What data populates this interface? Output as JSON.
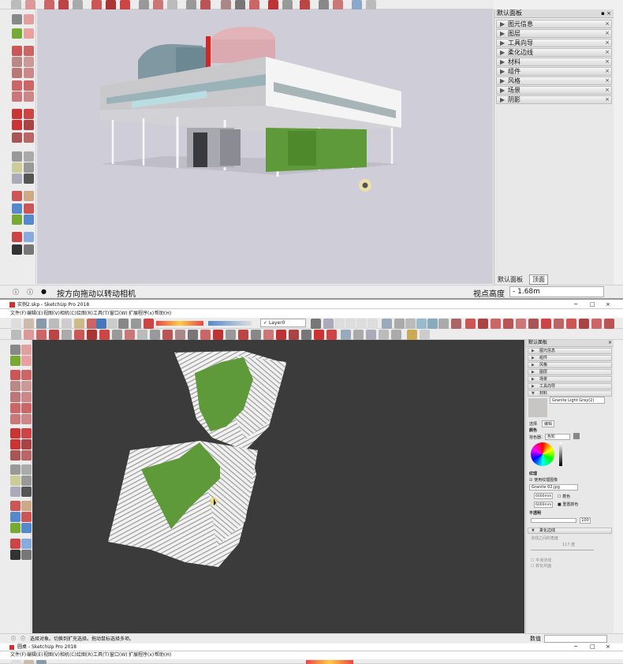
{
  "top": {
    "right_panel": {
      "title": "默认面板",
      "sections": [
        "图元信息",
        "图层",
        "工具向导",
        "柔化边线",
        "材料",
        "组件",
        "风格",
        "场景",
        "阴影"
      ],
      "tabs": [
        "默认面板",
        "顶面"
      ]
    },
    "status_text": "按方向拖动以转动相机",
    "measure_label": "视点高度",
    "measure_value": "- 1.68m"
  },
  "middle": {
    "window_title": "实例2.skp - SketchUp Pro 2018",
    "menu": [
      "文件(F)",
      "编辑(E)",
      "视图(V)",
      "相机(C)",
      "绘图(R)",
      "工具(T)",
      "窗口(W)",
      "扩展程序(x)",
      "帮助(H)"
    ],
    "layer_select": "Layer0",
    "right_panel": {
      "title": "默认面板",
      "sections": [
        "图元信息",
        "组件",
        "风格",
        "图层",
        "场景",
        "工具向导",
        "材料"
      ],
      "material_name": "Granite Light Gray(2)",
      "tabs": [
        "选择",
        "编辑"
      ],
      "color_label": "颜色",
      "picker_label": "拾色器：",
      "picker_value": "色轮",
      "texture_label": "纹理",
      "use_texture": "使用纹理图像",
      "texture_file": "Granite 02.jpg",
      "width_value": "6000mm",
      "height_value": "6000mm",
      "colorize_label": "着色",
      "reset_label": "重置颜色",
      "opacity_label": "不透明",
      "opacity_value": "100",
      "soften_title": "柔化边线",
      "soften_angle_label": "法线之间的角度",
      "soften_angle_value": "117 度",
      "smooth_label": "平滑法线",
      "coplanar_label": "软化共面"
    },
    "status_text": "选择对象。切换到扩充选择。拖动鼠标选择多项。",
    "measure_label": "数值"
  },
  "bottom": {
    "window_title": "圆桌 - SketchUp Pro 2018",
    "menu": [
      "文件(F)",
      "编辑(E)",
      "视图(V)",
      "相机(C)",
      "绘图(R)",
      "工具(T)",
      "窗口(W)",
      "扩展程序(x)",
      "帮助(H)"
    ]
  },
  "colors": {
    "viewport_top": "#cfcdd8",
    "viewport_middle": "#3b3b3b",
    "grass": "#5e9a3a"
  }
}
